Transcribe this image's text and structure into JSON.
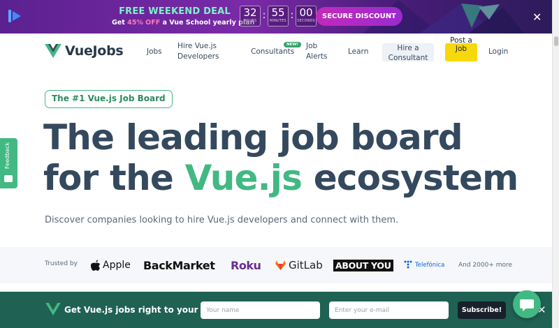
{
  "promo": {
    "title": "FREE WEEKEND DEAL",
    "sub_prefix": "Get ",
    "sub_highlight": "45% OFF",
    "sub_suffix": " a Vue School yearly plan",
    "countdown": [
      {
        "value": "32",
        "label": "HOURS"
      },
      {
        "value": "55",
        "label": "MINUTES"
      },
      {
        "value": "00",
        "label": "SECONDS"
      }
    ],
    "cta": "SECURE DISCOUNT",
    "close": "✕"
  },
  "nav": {
    "brand": "VueJobs",
    "links": {
      "jobs": "Jobs",
      "hire": "Hire Vue.js Developers",
      "consultants": "Consultants",
      "new_badge": "NEW!",
      "alerts": "Job Alerts",
      "learn": "Learn",
      "hire_consultant": "Hire a Consultant",
      "post_job": "Post a Job",
      "login": "Login"
    }
  },
  "hero": {
    "tagline": "The #1 Vue.js Job Board",
    "line1": "The leading job board",
    "line2_prefix": "for the ",
    "line2_green": "Vue.js",
    "line2_suffix": " ecosystem",
    "lede": "Discover companies looking to hire Vue.js developers and connect with them."
  },
  "trusted": {
    "label": "Trusted by",
    "logos": [
      "Apple",
      "BackMarket",
      "Roku",
      "GitLab",
      "ABOUT YOU",
      "Telefónica"
    ],
    "more": "And 2000+ more"
  },
  "feedback": {
    "label": "Feedback"
  },
  "signup": {
    "text": "Get Vue.js jobs right to your inbox",
    "name_placeholder": "Your name",
    "email_placeholder": "Enter your e-mail",
    "button": "Subscribe!",
    "close": "✕"
  },
  "colors": {
    "accent": "#42b883",
    "text": "#34495e",
    "promo_bg": "#6b2799",
    "signup_bg": "#1f6153",
    "post_btn": "#f6d80d"
  }
}
